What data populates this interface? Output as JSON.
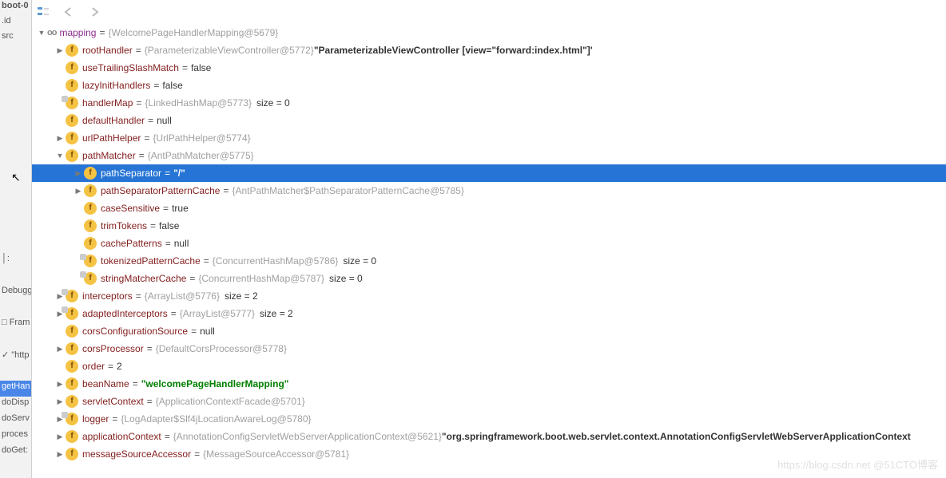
{
  "leftStrip": [
    {
      "label": "boot-0",
      "bold": true
    },
    {
      "label": ".id",
      "icon": true
    },
    {
      "label": "src",
      "icon": true
    },
    {
      "label": ""
    },
    {
      "label": ""
    },
    {
      "label": ""
    },
    {
      "label": ""
    },
    {
      "label": ""
    },
    {
      "label": ""
    },
    {
      "label": ""
    },
    {
      "label": ""
    },
    {
      "label": ""
    },
    {
      "label": ""
    },
    {
      "label": ""
    },
    {
      "label": ""
    },
    {
      "label": ""
    },
    {
      "label": "│:"
    },
    {
      "label": ""
    },
    {
      "label": "Debugge"
    },
    {
      "label": ""
    },
    {
      "label": "□ Fram"
    },
    {
      "label": ""
    },
    {
      "label": "✓ \"http"
    },
    {
      "label": ""
    },
    {
      "label": "getHan",
      "sel": true
    },
    {
      "label": "doDisp"
    },
    {
      "label": "doServ"
    },
    {
      "label": "proces"
    },
    {
      "label": "doGet:"
    }
  ],
  "rootRow": {
    "name": "mapping",
    "ref": "{WelcomePageHandlerMapping@5679}"
  },
  "nodes": [
    {
      "depth": 1,
      "chev": "r",
      "name": "rootHandler",
      "ref": "{ParameterizableViewController@5772}",
      "str": "\"ParameterizableViewController [view=\"forward:index.html\"]'"
    },
    {
      "depth": 1,
      "chev": "",
      "name": "useTrailingSlashMatch",
      "prim": "false"
    },
    {
      "depth": 1,
      "chev": "",
      "name": "lazyInitHandlers",
      "prim": "false"
    },
    {
      "depth": 1,
      "chev": "",
      "deco": true,
      "name": "handlerMap",
      "ref": "{LinkedHashMap@5773}",
      "size": "size = 0"
    },
    {
      "depth": 1,
      "chev": "",
      "name": "defaultHandler",
      "prim": "null"
    },
    {
      "depth": 1,
      "chev": "r",
      "name": "urlPathHelper",
      "ref": "{UrlPathHelper@5774}"
    },
    {
      "depth": 1,
      "chev": "d",
      "name": "pathMatcher",
      "ref": "{AntPathMatcher@5775}"
    },
    {
      "depth": 2,
      "chev": "r",
      "name": "pathSeparator",
      "str": "\"/\"",
      "sel": true
    },
    {
      "depth": 2,
      "chev": "r",
      "name": "pathSeparatorPatternCache",
      "ref": "{AntPathMatcher$PathSeparatorPatternCache@5785}"
    },
    {
      "depth": 2,
      "chev": "",
      "name": "caseSensitive",
      "prim": "true"
    },
    {
      "depth": 2,
      "chev": "",
      "name": "trimTokens",
      "prim": "false"
    },
    {
      "depth": 2,
      "chev": "",
      "name": "cachePatterns",
      "prim": "null"
    },
    {
      "depth": 2,
      "chev": "",
      "deco": true,
      "name": "tokenizedPatternCache",
      "ref": "{ConcurrentHashMap@5786}",
      "size": "size = 0"
    },
    {
      "depth": 2,
      "chev": "",
      "deco": true,
      "name": "stringMatcherCache",
      "ref": "{ConcurrentHashMap@5787}",
      "size": "size = 0"
    },
    {
      "depth": 1,
      "chev": "r",
      "deco": true,
      "name": "interceptors",
      "ref": "{ArrayList@5776}",
      "size": "size = 2"
    },
    {
      "depth": 1,
      "chev": "r",
      "deco": true,
      "name": "adaptedInterceptors",
      "ref": "{ArrayList@5777}",
      "size": "size = 2"
    },
    {
      "depth": 1,
      "chev": "",
      "name": "corsConfigurationSource",
      "prim": "null"
    },
    {
      "depth": 1,
      "chev": "r",
      "name": "corsProcessor",
      "ref": "{DefaultCorsProcessor@5778}"
    },
    {
      "depth": 1,
      "chev": "",
      "name": "order",
      "prim": "2"
    },
    {
      "depth": 1,
      "chev": "r",
      "name": "beanName",
      "str": "\"welcomePageHandlerMapping\"",
      "green": true
    },
    {
      "depth": 1,
      "chev": "r",
      "name": "servletContext",
      "ref": "{ApplicationContextFacade@5701}"
    },
    {
      "depth": 1,
      "chev": "r",
      "deco": true,
      "name": "logger",
      "ref": "{LogAdapter$Slf4jLocationAwareLog@5780}"
    },
    {
      "depth": 1,
      "chev": "r",
      "name": "applicationContext",
      "ref": "{AnnotationConfigServletWebServerApplicationContext@5621}",
      "str": "\"org.springframework.boot.web.servlet.context.AnnotationConfigServletWebServerApplicationContext"
    },
    {
      "depth": 1,
      "chev": "r",
      "name": "messageSourceAccessor",
      "ref": "{MessageSourceAccessor@5781}"
    }
  ],
  "watermark": "https://blog.csdn.net @51CTO博客",
  "badgeLetter": "f"
}
